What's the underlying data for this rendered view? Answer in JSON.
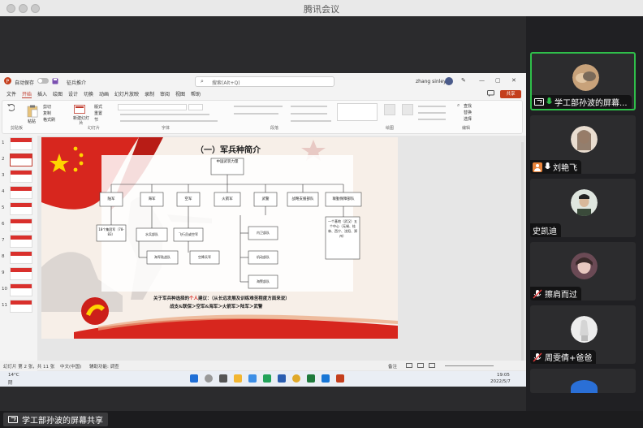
{
  "app": {
    "title": "腾讯会议"
  },
  "powerpoint": {
    "autosave_label": "自动保存",
    "file_name": "征兵推介",
    "search_placeholder": "搜索(Alt+Q)",
    "user_name": "zhang sinley",
    "menu": [
      "文件",
      "开始",
      "插入",
      "绘图",
      "设计",
      "切换",
      "动画",
      "幻灯片放映",
      "录制",
      "审阅",
      "视图",
      "帮助"
    ],
    "active_menu": "开始",
    "share_label": "共享",
    "ribbon_groups": [
      "剪贴板",
      "幻灯片",
      "字体",
      "段落",
      "绘图",
      "编辑"
    ],
    "ribbon_items": {
      "paste": "粘贴",
      "cut": "剪切",
      "copy": "复制",
      "format_painter": "格式刷",
      "new_slide": "新建幻灯片",
      "layout": "版式",
      "reset": "重置",
      "section": "节",
      "find": "查找",
      "replace": "替换",
      "select": "选择"
    },
    "thumbnail_numbers": [
      "1",
      "2",
      "3",
      "4",
      "5",
      "6",
      "7",
      "8",
      "9",
      "10",
      "11"
    ],
    "selected_thumbnail": 2,
    "status_slide": "幻灯片 第 2 张，共 11 张",
    "status_lang": "中文(中国)",
    "status_access": "辅助功能: 调查",
    "status_notes": "备注",
    "weather": "14°C",
    "weather_sub": "阴",
    "clock_time": "19:05",
    "clock_date": "2022/5/7"
  },
  "slide": {
    "title": "（一）军兵种简介",
    "root_node": "中国武装力量",
    "branches": [
      "陆军",
      "海军",
      "空军",
      "火箭军",
      "武警",
      "战略支援部队",
      "联勤保障部队"
    ],
    "sub_nodes": {
      "army": "18个集团军（78-83）",
      "navy_1": "水兵部队",
      "navy_2": "海军陆战队",
      "air_1": "飞行员或空军",
      "air_2": "空降兵军",
      "police_1": "内卫部队",
      "police_2": "机动部队",
      "police_3": "海警部队",
      "logistics": "一个基地（武汉）五个中心（无锡、桂林、西宁、沈阳、郑州）"
    },
    "advice_line1_prefix": "关于军兵种选择的",
    "advice_line1_highlight": "个人",
    "advice_line1_suffix": "建议：（从长远发展及训练难苦程度方面来说）",
    "advice_line2": "战支&联保＞空军&海军＞火箭军＞陆军＞武警"
  },
  "participants": [
    {
      "name": "学工部孙波的屏幕...",
      "sharing": true,
      "mic": "on",
      "active": true
    },
    {
      "name": "刘艳飞",
      "sharing": false,
      "mic": "on",
      "active": false
    },
    {
      "name": "史凯迪",
      "sharing": false,
      "mic": "none",
      "active": false
    },
    {
      "name": "擦肩而过",
      "sharing": false,
      "mic": "off",
      "active": false
    },
    {
      "name": "周雯倩+爸爸",
      "sharing": false,
      "mic": "off",
      "active": false
    }
  ],
  "screen_share_label": "学工部孙波的屏幕共享",
  "colors": {
    "accent_red": "#c0392b",
    "active_border": "#2fbf4a",
    "mic_green": "#2fbf4a",
    "panel_bg": "#202023"
  }
}
